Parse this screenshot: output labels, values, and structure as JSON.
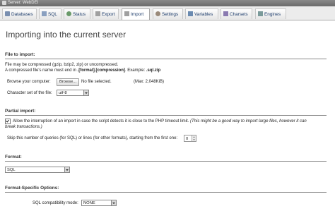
{
  "window": {
    "title": "Server: WebDEI"
  },
  "tabs": [
    {
      "label": "Databases",
      "icon": "databases-icon",
      "color": "#7a8fb0"
    },
    {
      "label": "SQL",
      "icon": "sql-icon",
      "color": "#8aa0c0"
    },
    {
      "label": "Status",
      "icon": "status-icon",
      "color": "#6a9a6a"
    },
    {
      "label": "Export",
      "icon": "export-icon",
      "color": "#a0a0a0"
    },
    {
      "label": "Import",
      "icon": "import-icon",
      "color": "#a0a0a0"
    },
    {
      "label": "Settings",
      "icon": "settings-icon",
      "color": "#9a8a7a"
    },
    {
      "label": "Variables",
      "icon": "variables-icon",
      "color": "#6a8ab0"
    },
    {
      "label": "Charsets",
      "icon": "charsets-icon",
      "color": "#8a7ab0"
    },
    {
      "label": "Engines",
      "icon": "engines-icon",
      "color": "#7a9a9a"
    }
  ],
  "active_tab": "Import",
  "page": {
    "title": "Importing into the current server"
  },
  "file_to_import": {
    "legend": "File to import:",
    "note1": "File may be compressed (gzip, bzip2, zip) or uncompressed.",
    "note2_prefix": "A compressed file's name must end in ",
    "note2_bold": ".[format].[compression]",
    "note2_mid": ". Example: ",
    "note2_example": ".sql.zip",
    "browse_label": "Browse your computer:",
    "browse_button": "Browse...",
    "no_file": "No file selected.",
    "max_size": "(Max: 2,048KiB)",
    "charset_label": "Character set of the file:",
    "charset_value": "utf-8"
  },
  "partial_import": {
    "legend": "Partial import:",
    "allow_interrupt": "Allow the interruption of an import in case the script detects it is close to the PHP timeout limit.",
    "allow_interrupt_note": "(This might be a good way to import large files, however it can",
    "allow_interrupt_note2": "break transactions.)",
    "skip_label": "Skip this number of queries (for SQL) or lines (for other formats), starting from the first one:",
    "skip_value": "0"
  },
  "format": {
    "legend": "Format:",
    "value": "SQL"
  },
  "format_options": {
    "legend": "Format-Specific Options:",
    "compat_label": "SQL compatibility mode:",
    "compat_value": "NONE"
  }
}
